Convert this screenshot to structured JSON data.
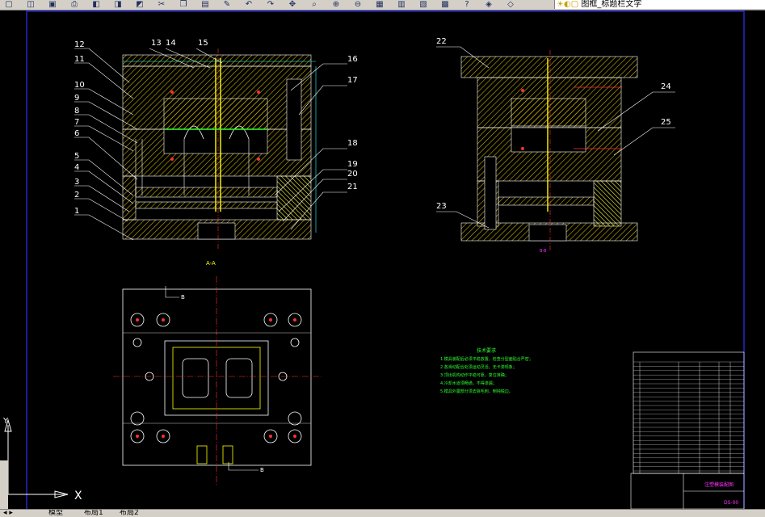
{
  "toolbar": {
    "icons": [
      "new-icon",
      "open-icon",
      "save-icon",
      "print-icon",
      "preview-icon",
      "publish-icon",
      "plot-icon",
      "cut-icon",
      "copy-icon",
      "paste-icon",
      "match-icon",
      "undo-icon",
      "redo-icon",
      "pan-icon",
      "zoom-realtime-icon",
      "zoom-window-icon",
      "zoom-previous-icon",
      "properties-icon",
      "design-center-icon",
      "tool-palettes-icon",
      "calculator-icon",
      "help-icon",
      "layer-icon",
      "layer-state-icon"
    ],
    "layer_name": "图框_标题栏文字"
  },
  "drawing": {
    "part_numbers_left": [
      "12",
      "11",
      "10",
      "9",
      "8",
      "7",
      "6",
      "5",
      "4",
      "3",
      "2",
      "1"
    ],
    "part_numbers_top": [
      "13",
      "14",
      "15",
      "16",
      "17",
      "18",
      "19",
      "20",
      "21"
    ],
    "part_numbers_right": [
      "22",
      "24",
      "25",
      "23"
    ],
    "section_label_left": "A-A",
    "section_label_right": "B-B",
    "section_marker": "B",
    "tech_title": "技术要求",
    "tech_lines": [
      "1.模具装配后必须平稳放置，检查分型面贴合严密；",
      "2.各滑动配合处须运动灵活，无卡滞现象；",
      "3.顶出机构动作平稳可靠，复位准确；",
      "4.冷却水道须畅通，不得渗漏；",
      "5.模具外露部分须去除毛刺，倒钝锐边。"
    ],
    "title_block_name": "注塑模装配图",
    "title_block_code": "DS-00"
  },
  "ucs": {
    "x": "X",
    "y": "Y"
  },
  "statusbar": {
    "tabs": [
      "模型",
      "布局1",
      "布局2"
    ]
  },
  "colors": {
    "background": "#000000",
    "frame": "#3030ff",
    "lines": "#ffffff",
    "hatch": "#ffff00",
    "red": "#ff3030",
    "magenta": "#ff30ff",
    "green": "#30ff30",
    "cyan": "#30ffff"
  }
}
